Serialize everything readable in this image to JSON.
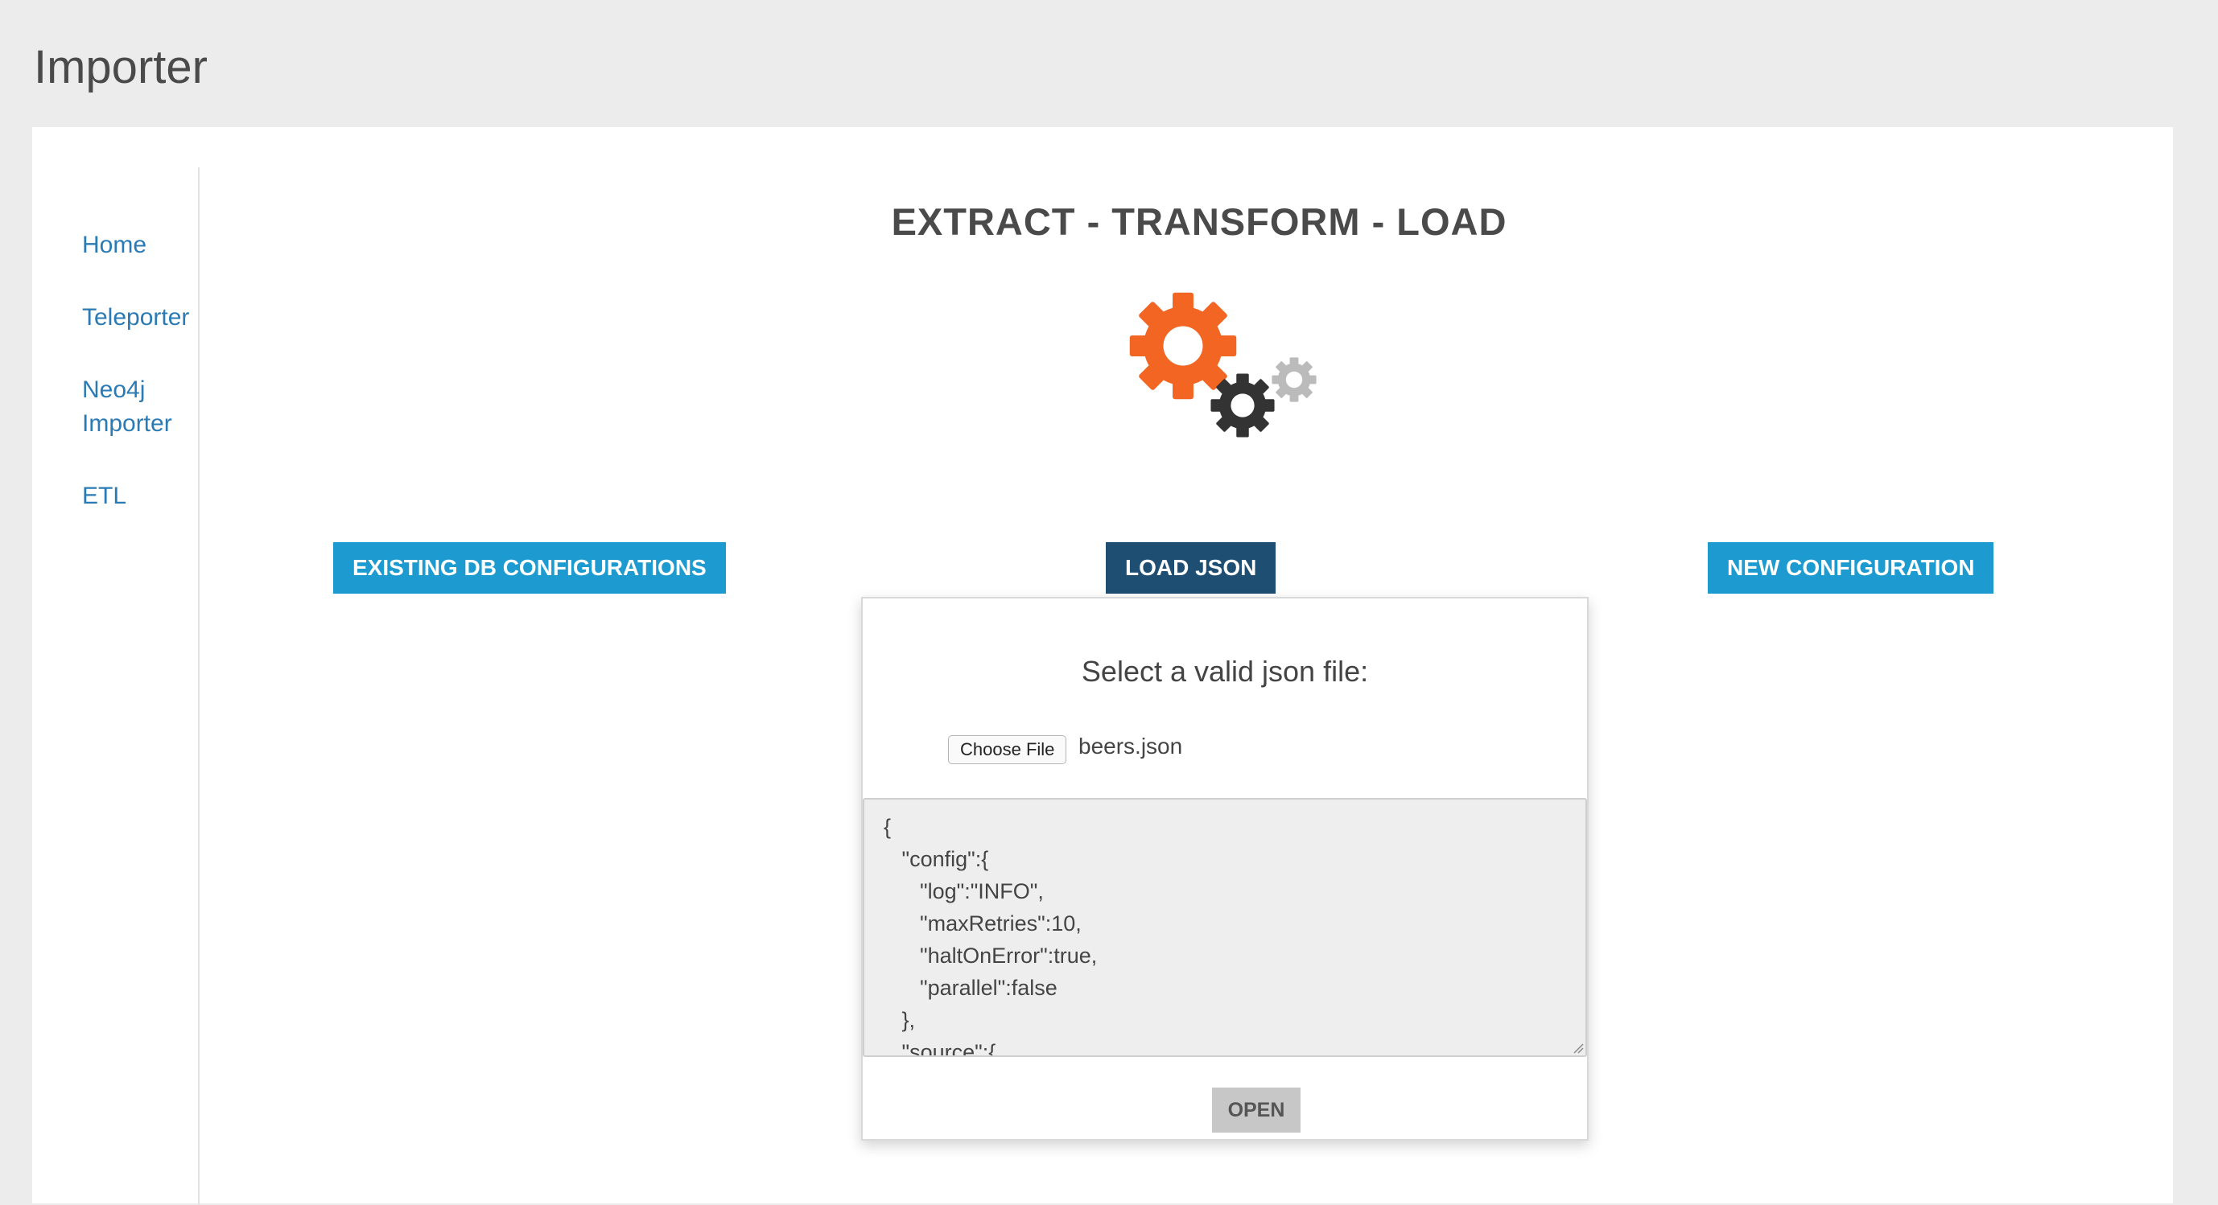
{
  "header": {
    "title": "Importer"
  },
  "sidebar": {
    "items": [
      {
        "label": "Home"
      },
      {
        "label": "Teleporter"
      },
      {
        "label": "Neo4j Importer"
      },
      {
        "label": "ETL"
      }
    ]
  },
  "main": {
    "title": "EXTRACT - TRANSFORM - LOAD",
    "logo_icon": "gears-icon",
    "colors": {
      "gear_large": "#f26522",
      "gear_medium": "#333333",
      "gear_small": "#bbbbbb"
    },
    "buttons": {
      "existing": "EXISTING DB CONFIGURATIONS",
      "load_json": "LOAD JSON",
      "new_config": "NEW CONFIGURATION"
    }
  },
  "modal": {
    "title": "Select a valid json file:",
    "choose_file_label": "Choose File",
    "file_name": "beers.json",
    "json_content": "{\n   \"config\":{\n      \"log\":\"INFO\",\n      \"maxRetries\":10,\n      \"haltOnError\":true,\n      \"parallel\":false\n   },\n   \"source\":{",
    "open_label": "OPEN"
  }
}
